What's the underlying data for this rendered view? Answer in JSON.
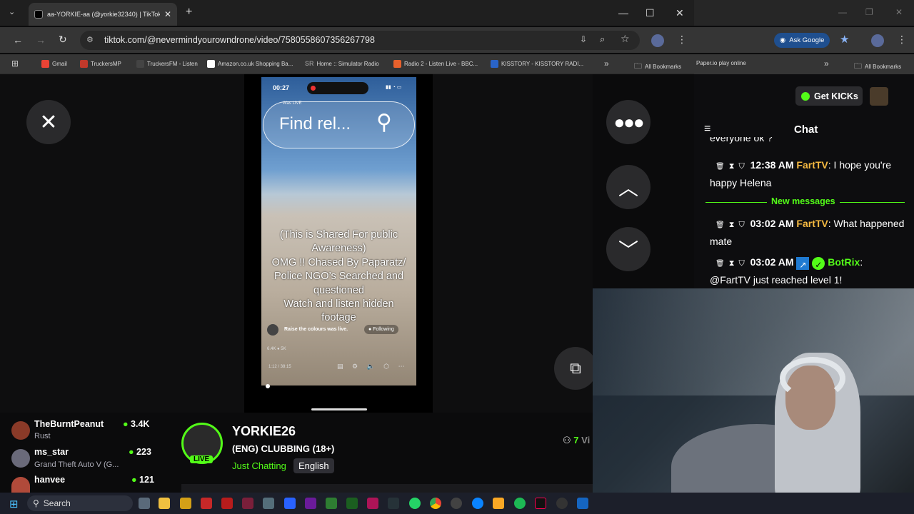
{
  "browser": {
    "tab_title": "аа-YORKIE-аа (@yorkie32340) | TikTok",
    "url": "tiktok.com/@nevermindyourowndrone/video/7580558607356267798",
    "ask_google": "Ask Google",
    "bookmarks": [
      {
        "label": "Gmail",
        "color": "#ea4335"
      },
      {
        "label": "TruckersMP",
        "color": "#c0392b"
      },
      {
        "label": "TruckersFM - Listen",
        "color": "#333333"
      },
      {
        "label": "Amazon.co.uk Shopping Ba...",
        "color": "#ffffff"
      },
      {
        "label": "Home :: Simulator Radio",
        "color": "#555555"
      },
      {
        "label": "Radio 2 - Listen Live - BBC...",
        "color": "#e8612c"
      },
      {
        "label": "KISSTORY - KISSTORY RADI...",
        "color": "#2a64c8"
      }
    ],
    "all_bookmarks": "All Bookmarks",
    "bookmarks_right": [
      {
        "label": "Paper.io play online"
      }
    ],
    "all_bookmarks_2": "All Bookmarks"
  },
  "video": {
    "status_time": "00:27",
    "was_live": "Was LIVE",
    "search_text": "Find rel...",
    "overlay_lines": [
      "(This is Shared For public",
      "Awareness)",
      "OMG !! Chased By Paparatz/",
      "Police NGO’s Searched and",
      "questioned",
      "Watch and listen hidden",
      "footage"
    ],
    "creator_line": "Raise the colours  was live.",
    "following": "Following",
    "stats": "6.4K  ● 5K",
    "timecode": "1:12 / 38:15"
  },
  "chat": {
    "get_kicks": "Get KICKs",
    "title": "Chat",
    "partial_top": "everyone ok ?",
    "new_messages": "New messages",
    "messages": [
      {
        "time": "12:38 AM",
        "user": "FartTV",
        "text": "I hope you're happy Helena"
      },
      {
        "time": "03:02 AM",
        "user": "FartTV",
        "text": "What happened mate"
      },
      {
        "time": "03:02 AM",
        "user": "BotRix",
        "text": "@FartTV just reached level 1!"
      }
    ]
  },
  "recommended": [
    {
      "name": "TheBurntPeanut",
      "game": "Rust",
      "viewers": "3.4K"
    },
    {
      "name": "ms_star",
      "game": "Grand Theft Auto V (G...",
      "viewers": "223"
    },
    {
      "name": "hanvee",
      "game": "",
      "viewers": "121"
    }
  ],
  "channel": {
    "name": "YORKIE26",
    "live_badge": "LIVE",
    "title": "(ENG) CLUBBING (18+)",
    "category": "Just Chatting",
    "language": "English",
    "viewers": "7",
    "viewers_suffix": "Vi"
  },
  "taskbar": {
    "search": "Search"
  }
}
